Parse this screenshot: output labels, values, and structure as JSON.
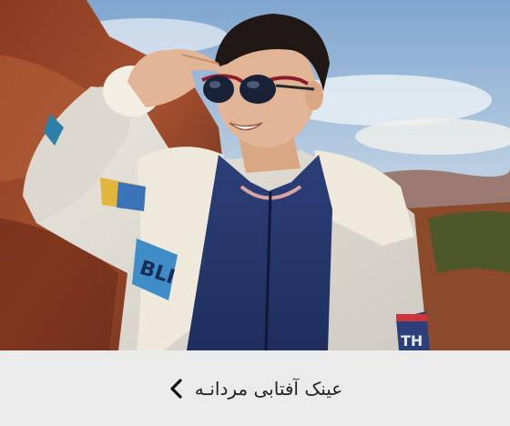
{
  "banner": {
    "image_alt": "man wearing sunglasses in shearling jacket outdoors",
    "caption": "عینک آفتابی مردانـه",
    "chevron_icon": "chevron-left-icon"
  },
  "colors": {
    "caption_bg": "#ebebeb",
    "caption_text": "#222222"
  }
}
